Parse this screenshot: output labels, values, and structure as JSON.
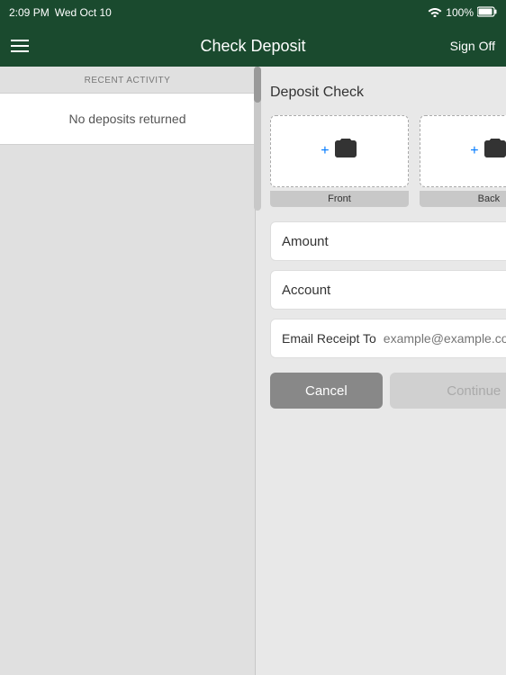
{
  "statusBar": {
    "time": "2:09 PM",
    "date": "Wed Oct 10",
    "battery": "100%"
  },
  "navBar": {
    "title": "Check Deposit",
    "signOffLabel": "Sign Off",
    "menuIcon": "hamburger-icon"
  },
  "leftPanel": {
    "recentActivityLabel": "RECENT ACTIVITY",
    "noDepositsText": "No deposits returned"
  },
  "rightPanel": {
    "depositCheckTitle": "Deposit Check",
    "frontLabel": "Front",
    "backLabel": "Back",
    "amountLabel": "Amount",
    "accountLabel": "Account",
    "emailReceiptLabel": "Email Receipt To",
    "emailPlaceholder": "example@example.com",
    "cancelLabel": "Cancel",
    "continueLabel": "Continue"
  }
}
